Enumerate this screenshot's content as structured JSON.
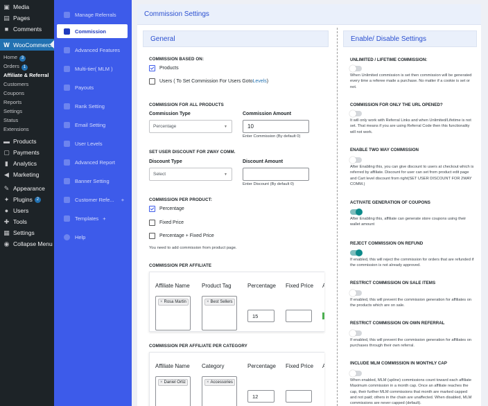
{
  "wp_menu": {
    "top": [
      {
        "label": "Media",
        "icon": "media-icon"
      },
      {
        "label": "Pages",
        "icon": "pages-icon"
      },
      {
        "label": "Comments",
        "icon": "comments-icon"
      }
    ],
    "woocommerce": {
      "label": "WooCommerce",
      "icon": "woocommerce-icon"
    },
    "woo_sub": [
      {
        "label": "Home",
        "badge": "3"
      },
      {
        "label": "Orders",
        "badge": "1"
      },
      {
        "label": "Affiliate & Referral",
        "current": true
      },
      {
        "label": "Customers"
      },
      {
        "label": "Coupons"
      },
      {
        "label": "Reports"
      },
      {
        "label": "Settings"
      },
      {
        "label": "Status"
      },
      {
        "label": "Extensions"
      }
    ],
    "bottom": [
      {
        "label": "Products",
        "icon": "products-icon"
      },
      {
        "label": "Payments",
        "icon": "payments-icon"
      },
      {
        "label": "Analytics",
        "icon": "analytics-icon"
      },
      {
        "label": "Marketing",
        "icon": "marketing-icon"
      },
      {
        "label": "Appearance",
        "icon": "appearance-icon"
      },
      {
        "label": "Plugins",
        "icon": "plugins-icon",
        "badge": "2"
      },
      {
        "label": "Users",
        "icon": "users-icon"
      },
      {
        "label": "Tools",
        "icon": "tools-icon"
      },
      {
        "label": "Settings",
        "icon": "settings-icon"
      },
      {
        "label": "Collapse Menu",
        "icon": "collapse-icon"
      }
    ]
  },
  "plugin_nav": [
    {
      "label": "Manage Referrals"
    },
    {
      "label": "Commission",
      "active": true
    },
    {
      "label": "Advanced Features"
    },
    {
      "label": "Multi-tier( MLM )"
    },
    {
      "label": "Payouts"
    },
    {
      "label": "Rank Setting"
    },
    {
      "label": "Email Setting"
    },
    {
      "label": "User Levels"
    },
    {
      "label": "Advanced Report"
    },
    {
      "label": "Banner Setting"
    },
    {
      "label": "Customer Refe...",
      "suffix": "+"
    },
    {
      "label": "Templates",
      "suffix": "+"
    },
    {
      "label": "Help"
    }
  ],
  "header": {
    "title": "Commission Settings"
  },
  "general": {
    "title": "General",
    "based_on": {
      "title": "COMMISSION BASED ON:",
      "products": "Products",
      "users_prefix": "Users ( To Set Commission For Users Goto ",
      "users_link": "Levels",
      "users_suffix": " )"
    },
    "all_products": {
      "title": "COMMISSION FOR ALL PRODUCTS",
      "type_label": "Commission Type",
      "type_value": "Percentage",
      "amount_label": "Commission Amount",
      "amount_value": "10",
      "amount_hint": "Enter Commission (By default 0)"
    },
    "user_discount": {
      "title": "SET USER DISCOUNT FOR 2WAY COMM.",
      "type_label": "Discount Type",
      "type_value": "Select",
      "amount_label": "Discount Amount",
      "amount_hint": "Enter Discount (By default 0)"
    },
    "per_product": {
      "title": "COMMISSION PER PRODUCT:",
      "opt1": "Percentage",
      "opt2": "Fixed Price",
      "opt3": "Percentage + Fixed Price",
      "note": "You need to add commission from product page."
    },
    "per_affiliate": {
      "title": "COMMISSION PER AFFILIATE",
      "headers": [
        "Affiliate Name",
        "Product Tag",
        "Percentage",
        "Fixed Price",
        "A"
      ],
      "affiliate_tag": "Rosa Martin",
      "product_tag": "Best Sellers",
      "percentage": "15",
      "fixed_price": ""
    },
    "per_affiliate_category": {
      "title": "COMMISSION PER AFFILIATE PER CATEGORY",
      "headers": [
        "Affiliate Name",
        "Category",
        "Percentage",
        "Fixed Price",
        "A"
      ],
      "affiliate_tag": "Daniel Ortiz",
      "category_tag": "Accessories",
      "percentage": "12",
      "fixed_price": ""
    }
  },
  "enable_disable": {
    "title": "Enable/ Disable Settings",
    "items": [
      {
        "title": "UNLIMITED / LIFETIME COMMISSION:",
        "on": false,
        "desc": "When Unlimited commission is set then commission will be generated every time a referee made a purchase. No matter if a cookie is set or not."
      },
      {
        "title": "COMMISSION FOR ONLY THE URL OPENED?",
        "on": false,
        "desc": "It will only work with Referral Links and when Unlimited/Lifetime is not set. That means if you are using Referral Code then this functionality will not work."
      },
      {
        "title": "ENABLE TWO WAY COMMISSION",
        "on": false,
        "desc": "After Enabling this, you can give discount to users at checkout which is referred by affiliate. Discount for user can set from product edit page and Cart level discount from right(SET USER DISCOUNT FOR 2WAY COMM.)"
      },
      {
        "title": "ACTIVATE GENERATION OF COUPONS",
        "on": true,
        "desc": "After Enabling this, affiliate can generate store coupons using their wallet amount"
      },
      {
        "title": "REJECT COMMISSION ON REFUND",
        "on": true,
        "desc": "If enabled, this will reject the commission for orders that are refunded if the commission is not already approved."
      },
      {
        "title": "RESTRICT COMMISSION ON SALE ITEMS",
        "on": false,
        "desc": "If enabled, this will prevent the commission generation for affiliates on the products which are on sale."
      },
      {
        "title": "RESTRICT COMMISSION ON OWN REFERRAL",
        "on": false,
        "desc": "If enabled, this will prevent the commission generation for affiliates on purchases through their own referral."
      },
      {
        "title": "INCLUDE MLM COMMISSION IN MONTHLY CAP",
        "on": false,
        "desc": "When enabled, MLM (upline) commissions count toward each affiliate Maximum commission in a month cap. Once an affiliate reaches the cap, their further MLM commissions that month are marked capped and not paid; others in the chain are unaffected. When disabled, MLM commissions are never capped (default)."
      }
    ]
  }
}
